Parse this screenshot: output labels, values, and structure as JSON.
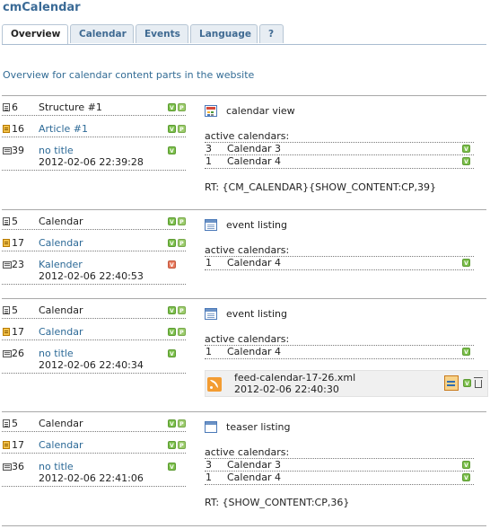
{
  "app": {
    "title": "cmCalendar"
  },
  "tabs": [
    "Overview",
    "Calendar",
    "Events",
    "Language",
    "?"
  ],
  "intro": "Overview for calendar content parts in the website",
  "badges": {
    "v": "V",
    "p": "P"
  },
  "blocks": [
    {
      "left": [
        {
          "kind": "page",
          "id": "6",
          "name": "Structure #1",
          "badges": [
            "v",
            "p"
          ]
        },
        {
          "kind": "article",
          "id": "16",
          "name": "Article #1",
          "badges": [
            "v",
            "p"
          ]
        },
        {
          "kind": "ce",
          "id": "39",
          "name": "no title",
          "date": "2012-02-06 22:39:28",
          "badges": [
            "v"
          ]
        }
      ],
      "right": {
        "icon": "calendar-view-icon",
        "title": "calendar view",
        "active_label": "active calendars:",
        "calendars": [
          {
            "num": "3",
            "name": "Calendar 3"
          },
          {
            "num": "1",
            "name": "Calendar 4"
          }
        ],
        "rt": "RT: {CM_CALENDAR}{SHOW_CONTENT:CP,39}"
      }
    },
    {
      "left": [
        {
          "kind": "page",
          "id": "5",
          "name": "Calendar",
          "badges": [
            "v",
            "p"
          ]
        },
        {
          "kind": "article",
          "id": "17",
          "name": "Calendar",
          "badges": [
            "v",
            "p"
          ]
        },
        {
          "kind": "ce",
          "id": "23",
          "name": "Kalender",
          "date": "2012-02-06 22:40:53",
          "badges": [
            "r"
          ]
        }
      ],
      "right": {
        "icon": "event-listing-icon",
        "title": "event listing",
        "active_label": "active calendars:",
        "calendars": [
          {
            "num": "1",
            "name": "Calendar 4"
          }
        ]
      }
    },
    {
      "left": [
        {
          "kind": "page",
          "id": "5",
          "name": "Calendar",
          "badges": [
            "v",
            "p"
          ]
        },
        {
          "kind": "article",
          "id": "17",
          "name": "Calendar",
          "badges": [
            "v",
            "p"
          ]
        },
        {
          "kind": "ce",
          "id": "26",
          "name": "no title",
          "date": "2012-02-06 22:40:34",
          "badges": [
            "v"
          ]
        }
      ],
      "right": {
        "icon": "event-listing-icon",
        "title": "event listing",
        "active_label": "active calendars:",
        "calendars": [
          {
            "num": "1",
            "name": "Calendar 4"
          }
        ],
        "feed": {
          "name": "feed-calendar-17-26.xml",
          "date": "2012-02-06 22:40:30"
        }
      }
    },
    {
      "left": [
        {
          "kind": "page",
          "id": "5",
          "name": "Calendar",
          "badges": [
            "v",
            "p"
          ]
        },
        {
          "kind": "article",
          "id": "17",
          "name": "Calendar",
          "badges": [
            "v",
            "p"
          ]
        },
        {
          "kind": "ce",
          "id": "36",
          "name": "no title",
          "date": "2012-02-06 22:41:06",
          "badges": [
            "v"
          ]
        }
      ],
      "right": {
        "icon": "teaser-listing-icon",
        "title": "teaser listing",
        "active_label": "active calendars:",
        "calendars": [
          {
            "num": "3",
            "name": "Calendar 3"
          },
          {
            "num": "1",
            "name": "Calendar 4"
          }
        ],
        "rt": "RT: {SHOW_CONTENT:CP,36}"
      }
    }
  ]
}
